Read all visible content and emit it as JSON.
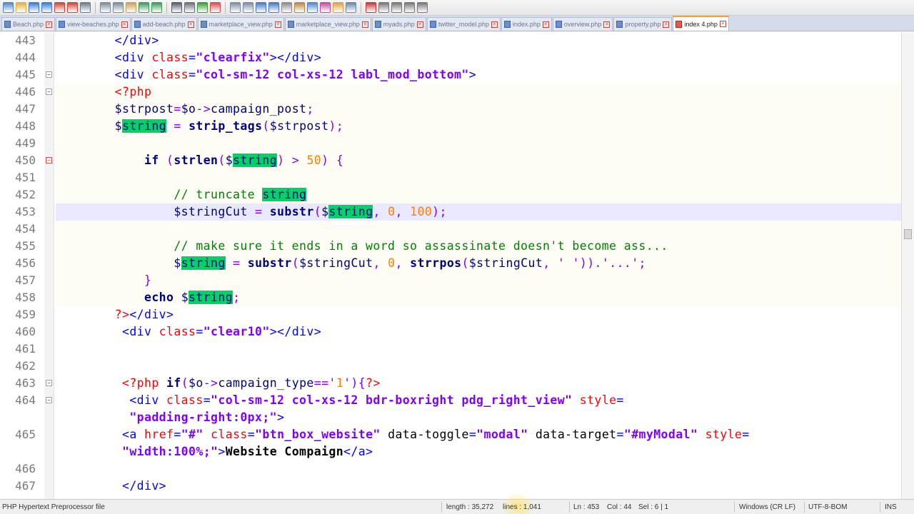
{
  "toolbar": {
    "icons": [
      "new-file-icon",
      "open-file-icon",
      "save-icon",
      "save-all-icon",
      "close-icon",
      "close-all-icon",
      "print-icon",
      "cut-icon",
      "copy-icon",
      "paste-icon",
      "undo-icon",
      "redo-icon",
      "find-icon",
      "replace-icon",
      "zoom-in-icon",
      "zoom-out-icon",
      "sync-v-icon",
      "sync-h-icon",
      "word-wrap-icon",
      "show-all-chars-icon",
      "indent-guide-icon",
      "udl-icon",
      "doc-map-icon",
      "function-list-icon",
      "folder-workspace-icon",
      "monitor-icon",
      "record-macro-icon",
      "stop-macro-icon",
      "play-macro-icon",
      "run-macro-icon",
      "save-macro-icon"
    ]
  },
  "tabs": [
    {
      "label": "Beach.php",
      "active": false
    },
    {
      "label": "view-beaches.php",
      "active": false
    },
    {
      "label": "add-beach.php",
      "active": false
    },
    {
      "label": "marketplace_view.php",
      "active": false
    },
    {
      "label": "marketplace_view.php",
      "active": false
    },
    {
      "label": "myads.php",
      "active": false
    },
    {
      "label": "twitter_model.php",
      "active": false
    },
    {
      "label": "index.php",
      "active": false
    },
    {
      "label": "overview.php",
      "active": false
    },
    {
      "label": "property.php",
      "active": false
    },
    {
      "label": "index 4.php",
      "active": true
    }
  ],
  "editor": {
    "lines": [
      {
        "n": "443",
        "fold": "",
        "tokens": [
          [
            "plain",
            "        "
          ],
          [
            "tag",
            "</div>"
          ]
        ]
      },
      {
        "n": "444",
        "fold": "",
        "tokens": [
          [
            "plain",
            "        "
          ],
          [
            "tag",
            "<div "
          ],
          [
            "attr",
            "class"
          ],
          [
            "tag",
            "="
          ],
          [
            "str",
            "\"clearfix\""
          ],
          [
            "tag",
            "></div>"
          ]
        ]
      },
      {
        "n": "445",
        "fold": "box",
        "tokens": [
          [
            "plain",
            "        "
          ],
          [
            "tag",
            "<div "
          ],
          [
            "attr",
            "class"
          ],
          [
            "tag",
            "="
          ],
          [
            "str",
            "\"col-sm-12 col-xs-12 labl_mod_bottom\""
          ],
          [
            "tag",
            ">"
          ]
        ]
      },
      {
        "n": "446",
        "fold": "box",
        "band": true,
        "tokens": [
          [
            "plain",
            "        "
          ],
          [
            "php",
            "<?php"
          ]
        ]
      },
      {
        "n": "447",
        "fold": "",
        "band": true,
        "tokens": [
          [
            "plain",
            "        "
          ],
          [
            "var",
            "$strpost"
          ],
          [
            "op",
            "="
          ],
          [
            "var",
            "$o"
          ],
          [
            "op",
            "->"
          ],
          [
            "var",
            "campaign_post"
          ],
          [
            "op",
            ";"
          ]
        ]
      },
      {
        "n": "448",
        "fold": "",
        "band": true,
        "tokens": [
          [
            "plain",
            "        "
          ],
          [
            "var",
            "$"
          ],
          [
            "hl",
            "string"
          ],
          [
            "plain",
            " "
          ],
          [
            "op",
            "="
          ],
          [
            "plain",
            " "
          ],
          [
            "kw",
            "strip_tags"
          ],
          [
            "op",
            "("
          ],
          [
            "var",
            "$strpost"
          ],
          [
            "op",
            ");"
          ]
        ]
      },
      {
        "n": "449",
        "fold": "",
        "band": true,
        "tokens": [
          [
            "plain",
            ""
          ]
        ]
      },
      {
        "n": "450",
        "fold": "red",
        "band": true,
        "tokens": [
          [
            "plain",
            "            "
          ],
          [
            "kw",
            "if"
          ],
          [
            "plain",
            " "
          ],
          [
            "op",
            "("
          ],
          [
            "kw",
            "strlen"
          ],
          [
            "op",
            "("
          ],
          [
            "var",
            "$"
          ],
          [
            "hl",
            "string"
          ],
          [
            "op",
            ")"
          ],
          [
            "plain",
            " "
          ],
          [
            "op",
            ">"
          ],
          [
            "plain",
            " "
          ],
          [
            "num",
            "50"
          ],
          [
            "op",
            ")"
          ],
          [
            "plain",
            " "
          ],
          [
            "op",
            "{"
          ]
        ]
      },
      {
        "n": "451",
        "fold": "",
        "band": true,
        "tokens": [
          [
            "plain",
            ""
          ]
        ]
      },
      {
        "n": "452",
        "fold": "",
        "band": true,
        "tokens": [
          [
            "plain",
            "                "
          ],
          [
            "cmt",
            "// truncate "
          ],
          [
            "hl",
            "string"
          ]
        ]
      },
      {
        "n": "453",
        "fold": "",
        "current": true,
        "tokens": [
          [
            "plain",
            "                "
          ],
          [
            "var",
            "$stringCut"
          ],
          [
            "plain",
            " "
          ],
          [
            "op",
            "="
          ],
          [
            "plain",
            " "
          ],
          [
            "kw",
            "substr"
          ],
          [
            "op",
            "("
          ],
          [
            "var",
            "$"
          ],
          [
            "hl",
            "string"
          ],
          [
            "op",
            ","
          ],
          [
            "plain",
            " "
          ],
          [
            "num",
            "0"
          ],
          [
            "op",
            ","
          ],
          [
            "plain",
            " "
          ],
          [
            "num",
            "100"
          ],
          [
            "op",
            ");"
          ]
        ]
      },
      {
        "n": "454",
        "fold": "",
        "band": true,
        "tokens": [
          [
            "plain",
            ""
          ]
        ]
      },
      {
        "n": "455",
        "fold": "",
        "band": true,
        "tokens": [
          [
            "plain",
            "                "
          ],
          [
            "cmt",
            "// make sure it ends in a word so assassinate doesn't become ass..."
          ]
        ]
      },
      {
        "n": "456",
        "fold": "",
        "band": true,
        "tokens": [
          [
            "plain",
            "                "
          ],
          [
            "var",
            "$"
          ],
          [
            "hl",
            "string"
          ],
          [
            "plain",
            " "
          ],
          [
            "op",
            "="
          ],
          [
            "plain",
            " "
          ],
          [
            "kw",
            "substr"
          ],
          [
            "op",
            "("
          ],
          [
            "var",
            "$stringCut"
          ],
          [
            "op",
            ","
          ],
          [
            "plain",
            " "
          ],
          [
            "num",
            "0"
          ],
          [
            "op",
            ","
          ],
          [
            "plain",
            " "
          ],
          [
            "kw",
            "strrpos"
          ],
          [
            "op",
            "("
          ],
          [
            "var",
            "$stringCut"
          ],
          [
            "op",
            ","
          ],
          [
            "plain",
            " "
          ],
          [
            "op",
            "' '"
          ],
          [
            "op",
            ")).'...';"
          ]
        ]
      },
      {
        "n": "457",
        "fold": "",
        "band": true,
        "tokens": [
          [
            "plain",
            "            "
          ],
          [
            "op",
            "}"
          ]
        ]
      },
      {
        "n": "458",
        "fold": "",
        "band": true,
        "tokens": [
          [
            "plain",
            "            "
          ],
          [
            "kw",
            "echo"
          ],
          [
            "plain",
            " "
          ],
          [
            "var",
            "$"
          ],
          [
            "hl",
            "string"
          ],
          [
            "op",
            ";"
          ]
        ]
      },
      {
        "n": "459",
        "fold": "",
        "tokens": [
          [
            "plain",
            "        "
          ],
          [
            "php",
            "?>"
          ],
          [
            "tag",
            "</div>"
          ]
        ]
      },
      {
        "n": "460",
        "fold": "",
        "tokens": [
          [
            "plain",
            "         "
          ],
          [
            "tag",
            "<div "
          ],
          [
            "attr",
            "class"
          ],
          [
            "tag",
            "="
          ],
          [
            "str",
            "\"clear10\""
          ],
          [
            "tag",
            "></div>"
          ]
        ]
      },
      {
        "n": "461",
        "fold": "",
        "tokens": [
          [
            "plain",
            ""
          ]
        ]
      },
      {
        "n": "462",
        "fold": "",
        "tokens": [
          [
            "plain",
            ""
          ]
        ]
      },
      {
        "n": "463",
        "fold": "box",
        "tokens": [
          [
            "plain",
            "         "
          ],
          [
            "php",
            "<?php "
          ],
          [
            "kw",
            "if"
          ],
          [
            "op",
            "("
          ],
          [
            "var",
            "$o"
          ],
          [
            "op",
            "->"
          ],
          [
            "var",
            "campaign_type"
          ],
          [
            "op",
            "=='"
          ],
          [
            "num",
            "1"
          ],
          [
            "op",
            "'){"
          ],
          [
            "php",
            "?>"
          ]
        ]
      },
      {
        "n": "464",
        "fold": "box",
        "tokens": [
          [
            "plain",
            "          "
          ],
          [
            "tag",
            "<div "
          ],
          [
            "attr",
            "class"
          ],
          [
            "tag",
            "="
          ],
          [
            "str",
            "\"col-sm-12 col-xs-12 bdr-boxright pdg_right_view\""
          ],
          [
            "plain",
            " "
          ],
          [
            "attr",
            "style"
          ],
          [
            "tag",
            "="
          ]
        ]
      },
      {
        "n": "",
        "fold": "",
        "tokens": [
          [
            "plain",
            "          "
          ],
          [
            "str",
            "\"padding-right:0px;\""
          ],
          [
            "tag",
            ">"
          ]
        ]
      },
      {
        "n": "465",
        "fold": "",
        "tokens": [
          [
            "plain",
            "         "
          ],
          [
            "tag",
            "<a "
          ],
          [
            "attr",
            "href"
          ],
          [
            "tag",
            "="
          ],
          [
            "str",
            "\"#\""
          ],
          [
            "plain",
            " "
          ],
          [
            "attr",
            "class"
          ],
          [
            "tag",
            "="
          ],
          [
            "str",
            "\"btn_box_website\""
          ],
          [
            "plain",
            " "
          ],
          [
            "plain",
            "data-toggle"
          ],
          [
            "tag",
            "="
          ],
          [
            "str",
            "\"modal\""
          ],
          [
            "plain",
            " "
          ],
          [
            "plain",
            "data-target"
          ],
          [
            "tag",
            "="
          ],
          [
            "str",
            "\"#myModal\""
          ],
          [
            "plain",
            " "
          ],
          [
            "attr",
            "style"
          ],
          [
            "tag",
            "="
          ]
        ]
      },
      {
        "n": "",
        "fold": "",
        "tokens": [
          [
            "plain",
            "         "
          ],
          [
            "str",
            "\"width:100%;\""
          ],
          [
            "tag",
            ">"
          ],
          [
            "txt",
            "Website Compaign"
          ],
          [
            "tag",
            "</a>"
          ]
        ]
      },
      {
        "n": "466",
        "fold": "",
        "tokens": [
          [
            "plain",
            ""
          ]
        ]
      },
      {
        "n": "467",
        "fold": "",
        "tokens": [
          [
            "plain",
            "         "
          ],
          [
            "tag",
            "</div>"
          ]
        ]
      }
    ]
  },
  "status": {
    "file_type": "PHP Hypertext Preprocessor file",
    "length": "length : 35,272",
    "lines": "lines : 1,041",
    "ln": "Ln : 453",
    "col": "Col : 44",
    "sel": "Sel : 6 | 1",
    "eol": "Windows (CR LF)",
    "encoding": "UTF-8-BOM",
    "mode": "INS"
  },
  "colors": {
    "tag": "#0000ff",
    "attr": "#ff0000",
    "string": "#8000ff",
    "php": "#ff0000",
    "var": "#000080",
    "comment": "#008000",
    "number": "#ff8000",
    "highlight": "#00d26a",
    "current_line": "#e8e8ff",
    "active_tab_accent": "#f2a03c"
  }
}
